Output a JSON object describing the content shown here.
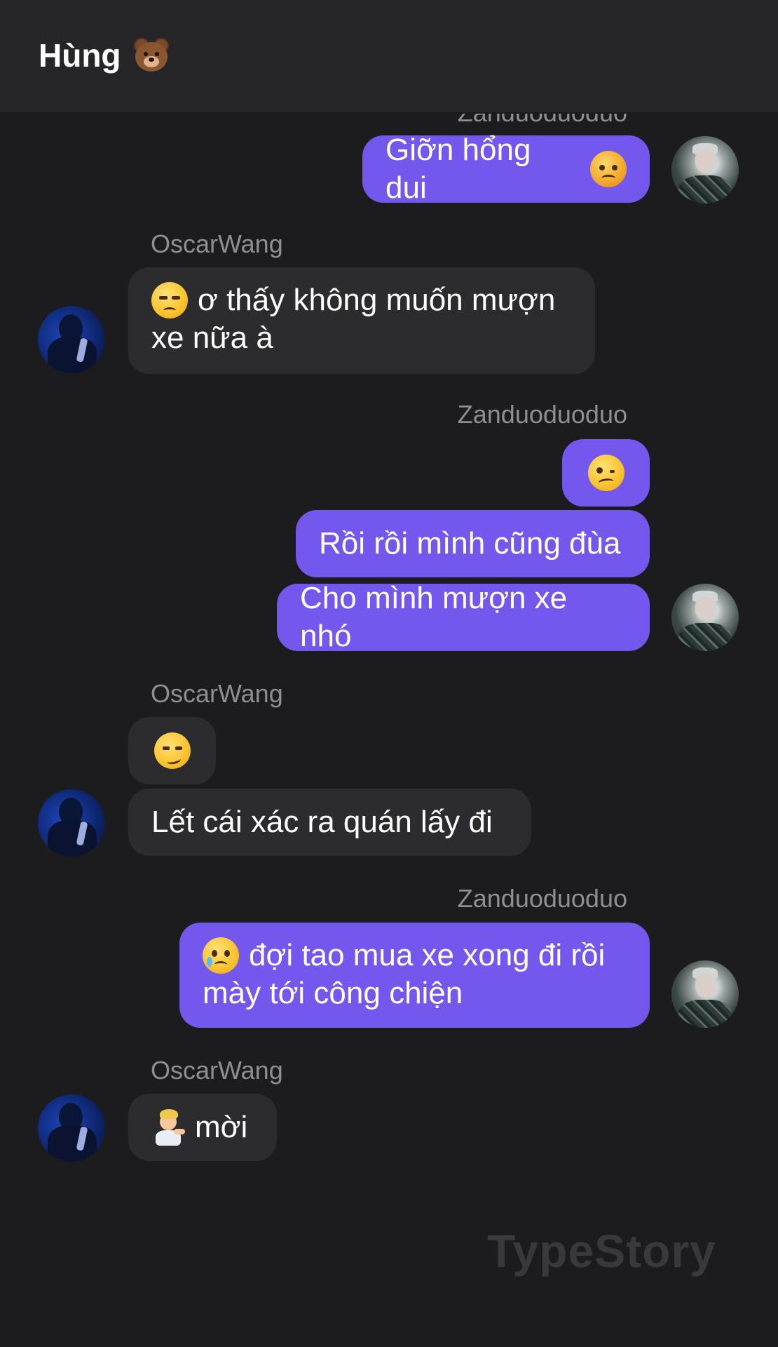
{
  "header": {
    "title": "Hùng",
    "title_icon": "bear-face-icon"
  },
  "messages": {
    "top_name_partial": "Zanduoduoduo",
    "m1": "Giỡn hổng dui",
    "m1_icon": "angry-face-icon",
    "oscar1_name": "OscarWang",
    "m2_line1": "ơ thấy không muốn mượn",
    "m2_line2": "xe nữa à",
    "m2_icon": "unamused-face-icon",
    "zan2_name": "Zanduoduoduo",
    "m3_icon": "woozy-face-icon",
    "m4": "Rồi rồi mình cũng đùa",
    "m5": "Cho mình mượn xe nhó",
    "oscar2_name": "OscarWang",
    "m6_icon": "smirking-face-icon",
    "m7": "Lết cái xác ra quán lấy đi",
    "zan3_name": "Zanduoduoduo",
    "m8_line1": "đợi tao mua xe xong đi rồi",
    "m8_line2": "mày tới công chiện",
    "m8_icon": "face-holding-back-tears-icon",
    "oscar3_name": "OscarWang",
    "m9": "mời",
    "m9_icon": "person-tipping-hand-icon"
  },
  "watermark": "TypeStory",
  "colors": {
    "background": "#1c1c1f",
    "header": "#262629",
    "my_bubble": "#7458ee",
    "their_bubble": "#2c2c2f",
    "name_label": "#8e8e93"
  }
}
